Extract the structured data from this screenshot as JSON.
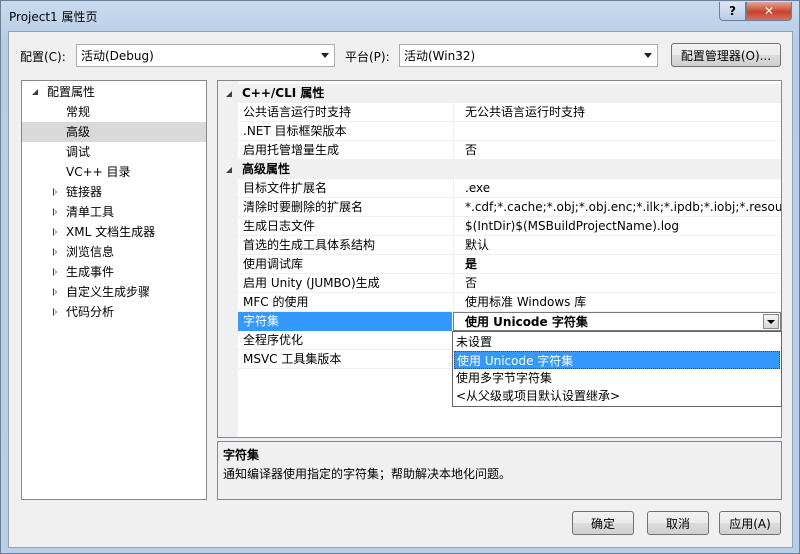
{
  "window": {
    "title": "Project1 属性页",
    "help_label": "?",
    "close_label": "✕"
  },
  "toolbar": {
    "config_label": "配置(C):",
    "config_value": "活动(Debug)",
    "platform_label": "平台(P):",
    "platform_value": "活动(Win32)",
    "config_manager_label": "配置管理器(O)..."
  },
  "tree": {
    "root": "配置属性",
    "items": [
      "常规",
      "高级",
      "调试",
      "VC++ 目录"
    ],
    "groups": [
      "链接器",
      "清单工具",
      "XML 文档生成器",
      "浏览信息",
      "生成事件",
      "自定义生成步骤",
      "代码分析"
    ],
    "selected": "高级"
  },
  "grid": {
    "categories": [
      "C++/CLI 属性",
      "高级属性"
    ],
    "cli_rows": [
      {
        "name": "公共语言运行时支持",
        "value": "无公共语言运行时支持"
      },
      {
        "name": ".NET 目标框架版本",
        "value": ""
      },
      {
        "name": "启用托管增量生成",
        "value": "否"
      }
    ],
    "adv_rows": [
      {
        "name": "目标文件扩展名",
        "value": ".exe"
      },
      {
        "name": "清除时要删除的扩展名",
        "value": "*.cdf;*.cache;*.obj;*.obj.enc;*.ilk;*.ipdb;*.iobj;*.resources;*"
      },
      {
        "name": "生成日志文件",
        "value": "$(IntDir)$(MSBuildProjectName).log"
      },
      {
        "name": "首选的生成工具体系结构",
        "value": "默认"
      },
      {
        "name": "使用调试库",
        "value": "是"
      },
      {
        "name": "启用 Unity (JUMBO)生成",
        "value": "否"
      },
      {
        "name": "MFC 的使用",
        "value": "使用标准 Windows 库"
      },
      {
        "name": "字符集",
        "value": "使用 Unicode 字符集"
      },
      {
        "name": "全程序优化",
        "value": ""
      },
      {
        "name": "MSVC 工具集版本",
        "value": ""
      }
    ]
  },
  "dropdown": {
    "options": [
      "未设置",
      "使用 Unicode 字符集",
      "使用多字节字符集",
      "<从父级或项目默认设置继承>"
    ],
    "selected": "使用 Unicode 字符集"
  },
  "description": {
    "title": "字符集",
    "text": "通知编译器使用指定的字符集；帮助解决本地化问题。"
  },
  "buttons": {
    "ok": "确定",
    "cancel": "取消",
    "apply": "应用(A)"
  }
}
